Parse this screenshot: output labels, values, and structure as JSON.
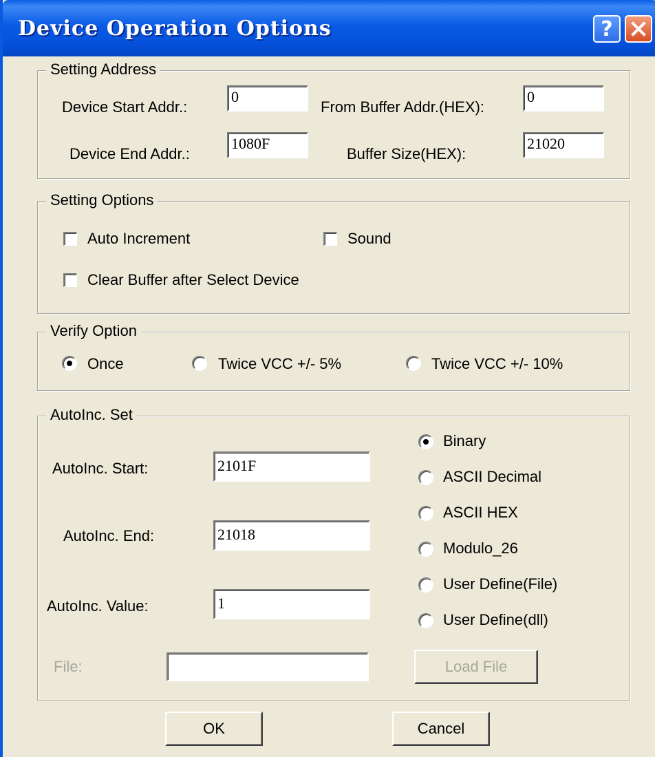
{
  "window": {
    "title": "Device Operation Options"
  },
  "setting_address": {
    "legend": "Setting Address",
    "device_start_label": "Device Start Addr.:",
    "device_start_value": "0",
    "from_buffer_label": "From Buffer Addr.(HEX):",
    "from_buffer_value": "0",
    "device_end_label": "Device End Addr.:",
    "device_end_value": "1080F",
    "buffer_size_label": "Buffer Size(HEX):",
    "buffer_size_value": "21020"
  },
  "setting_options": {
    "legend": "Setting Options",
    "auto_increment": {
      "label": "Auto Increment",
      "checked": false
    },
    "sound": {
      "label": "Sound",
      "checked": false
    },
    "clear_buffer": {
      "label": "Clear Buffer after Select Device",
      "checked": false
    }
  },
  "verify_option": {
    "legend": "Verify Option",
    "options": [
      {
        "label": "Once",
        "selected": true
      },
      {
        "label": "Twice VCC +/- 5%",
        "selected": false
      },
      {
        "label": "Twice VCC +/- 10%",
        "selected": false
      }
    ]
  },
  "autoinc": {
    "legend": "AutoInc. Set",
    "start_label": "AutoInc. Start:",
    "start_value": "2101F",
    "end_label": "AutoInc. End:",
    "end_value": "21018",
    "value_label": "AutoInc. Value:",
    "value_value": "1",
    "file_label": "File:",
    "file_value": "",
    "load_file_label": "Load File",
    "modes": [
      {
        "label": "Binary",
        "selected": true
      },
      {
        "label": "ASCII Decimal",
        "selected": false
      },
      {
        "label": "ASCII HEX",
        "selected": false
      },
      {
        "label": "Modulo_26",
        "selected": false
      },
      {
        "label": "User Define(File)",
        "selected": false
      },
      {
        "label": "User Define(dll)",
        "selected": false
      }
    ]
  },
  "buttons": {
    "ok": "OK",
    "cancel": "Cancel"
  },
  "colors": {
    "titlebar": "#0a5ae6",
    "dialog_bg": "#ece9d8",
    "disabled_text": "#a7a69b"
  }
}
